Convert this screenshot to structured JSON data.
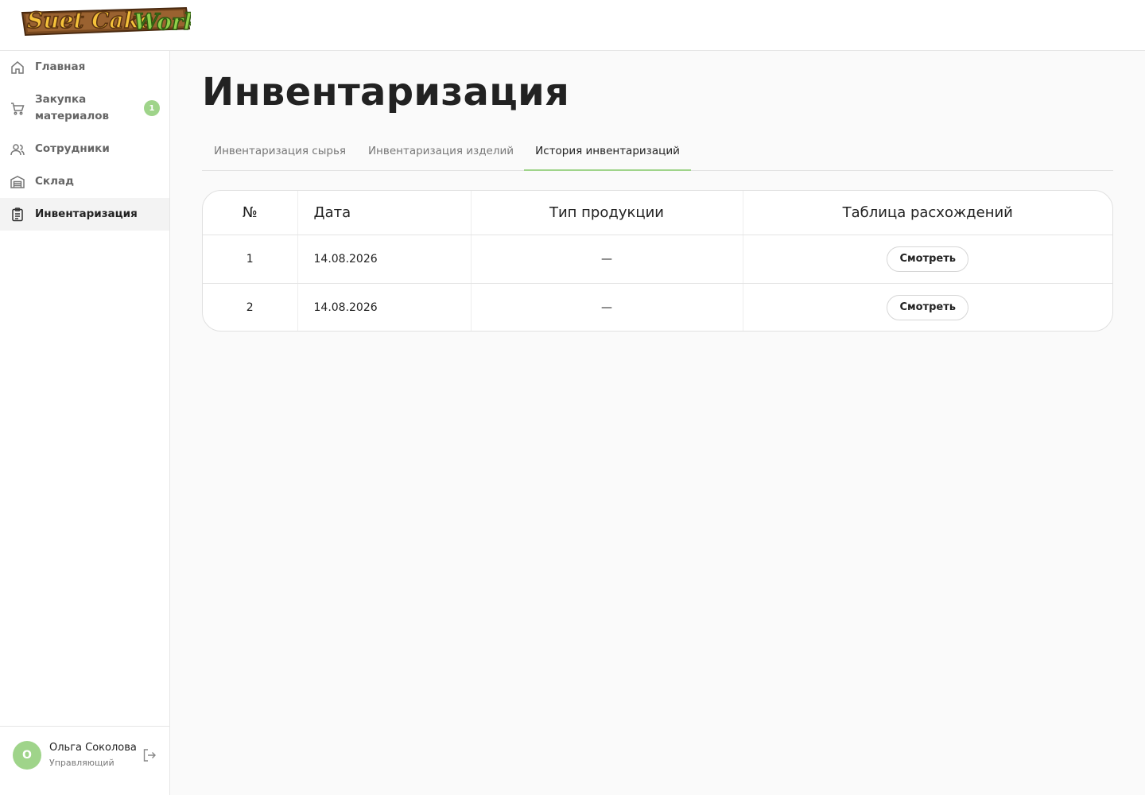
{
  "brand": {
    "logo_text_1": "Suet Cake",
    "logo_text_2": "Work"
  },
  "sidebar": {
    "items": [
      {
        "label": "Главная",
        "icon": "home-icon"
      },
      {
        "label": "Закупка материалов",
        "icon": "cart-icon",
        "badge": "1"
      },
      {
        "label": "Сотрудники",
        "icon": "users-icon"
      },
      {
        "label": "Склад",
        "icon": "warehouse-icon"
      },
      {
        "label": "Инвентаризация",
        "icon": "clipboard-icon",
        "active": true
      }
    ]
  },
  "user": {
    "initial": "О",
    "name": "Ольга Соколова",
    "role": "Управляющий"
  },
  "page": {
    "title": "Инвентаризация"
  },
  "tabs": [
    {
      "label": "Инвентаризация сырья"
    },
    {
      "label": "Инвентаризация изделий"
    },
    {
      "label": "История инвентаризаций",
      "active": true
    }
  ],
  "table": {
    "headers": [
      "№",
      "Дата",
      "Тип продукции",
      "Таблица расхождений"
    ],
    "rows": [
      {
        "num": "1",
        "date": "14.08.2026",
        "type": "—",
        "action": "Смотреть"
      },
      {
        "num": "2",
        "date": "14.08.2026",
        "type": "—",
        "action": "Смотреть"
      }
    ]
  },
  "colors": {
    "accent": "#9fd48a",
    "text": "#222222",
    "muted": "#777777",
    "background": "#fafafa"
  }
}
